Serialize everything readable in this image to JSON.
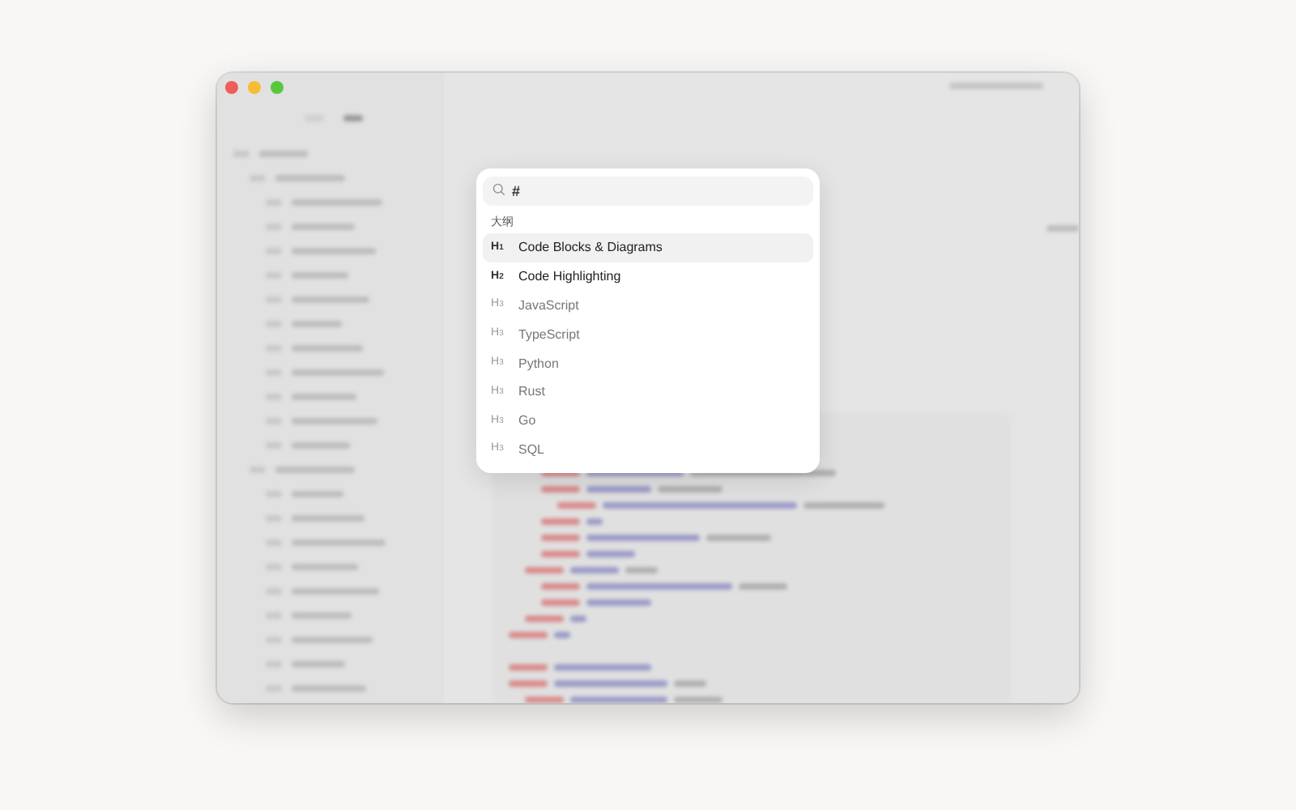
{
  "palette": {
    "query": "#",
    "group_label": "大纲",
    "items": [
      {
        "kind": "h1",
        "level_tag": "H$_{1}$",
        "label": "Code Blocks & Diagrams",
        "selected": true
      },
      {
        "kind": "h2",
        "level_tag": "H$_{2}$",
        "label": "Code Highlighting",
        "selected": false
      },
      {
        "kind": "h3",
        "level_tag": "H$_{3}$",
        "label": "JavaScript",
        "selected": false
      },
      {
        "kind": "h3",
        "level_tag": "H$_{3}$",
        "label": "TypeScript",
        "selected": false
      },
      {
        "kind": "h3",
        "level_tag": "H$_{3}$",
        "label": "Python",
        "selected": false
      },
      {
        "kind": "h3",
        "level_tag": "H$_{3}$",
        "label": "Rust",
        "selected": false
      },
      {
        "kind": "h3",
        "level_tag": "H$_{3}$",
        "label": "Go",
        "selected": false
      },
      {
        "kind": "h3",
        "level_tag": "H$_{3}$",
        "label": "SQL",
        "selected": false
      }
    ]
  }
}
